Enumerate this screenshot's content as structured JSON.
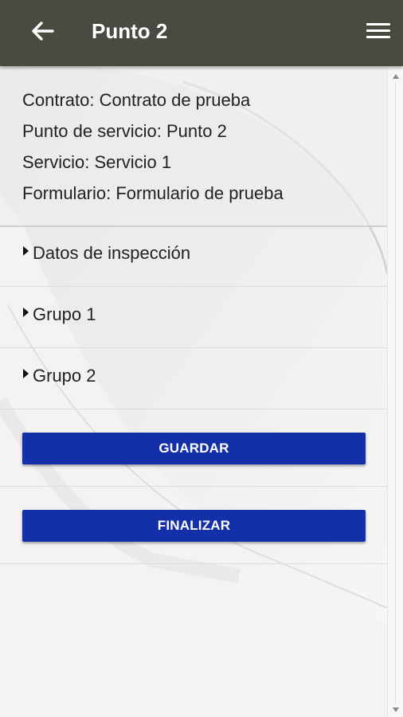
{
  "appbar": {
    "title": "Punto 2",
    "back_icon": "arrow-left-icon",
    "menu_icon": "hamburger-menu-icon",
    "background": "#4a4a40"
  },
  "info": {
    "contrato": "Contrato: Contrato de prueba",
    "punto_servicio": "Punto de servicio: Punto 2",
    "servicio": "Servicio: Servicio 1",
    "formulario": "Formulario: Formulario de prueba"
  },
  "sections": [
    {
      "label": "Datos de inspección",
      "icon": "caret-right-icon"
    },
    {
      "label": "Grupo 1",
      "icon": "caret-right-icon"
    },
    {
      "label": "Grupo 2",
      "icon": "caret-right-icon"
    }
  ],
  "buttons": {
    "save_label": "GUARDAR",
    "finish_label": "FINALIZAR",
    "color": "#1430a8"
  }
}
